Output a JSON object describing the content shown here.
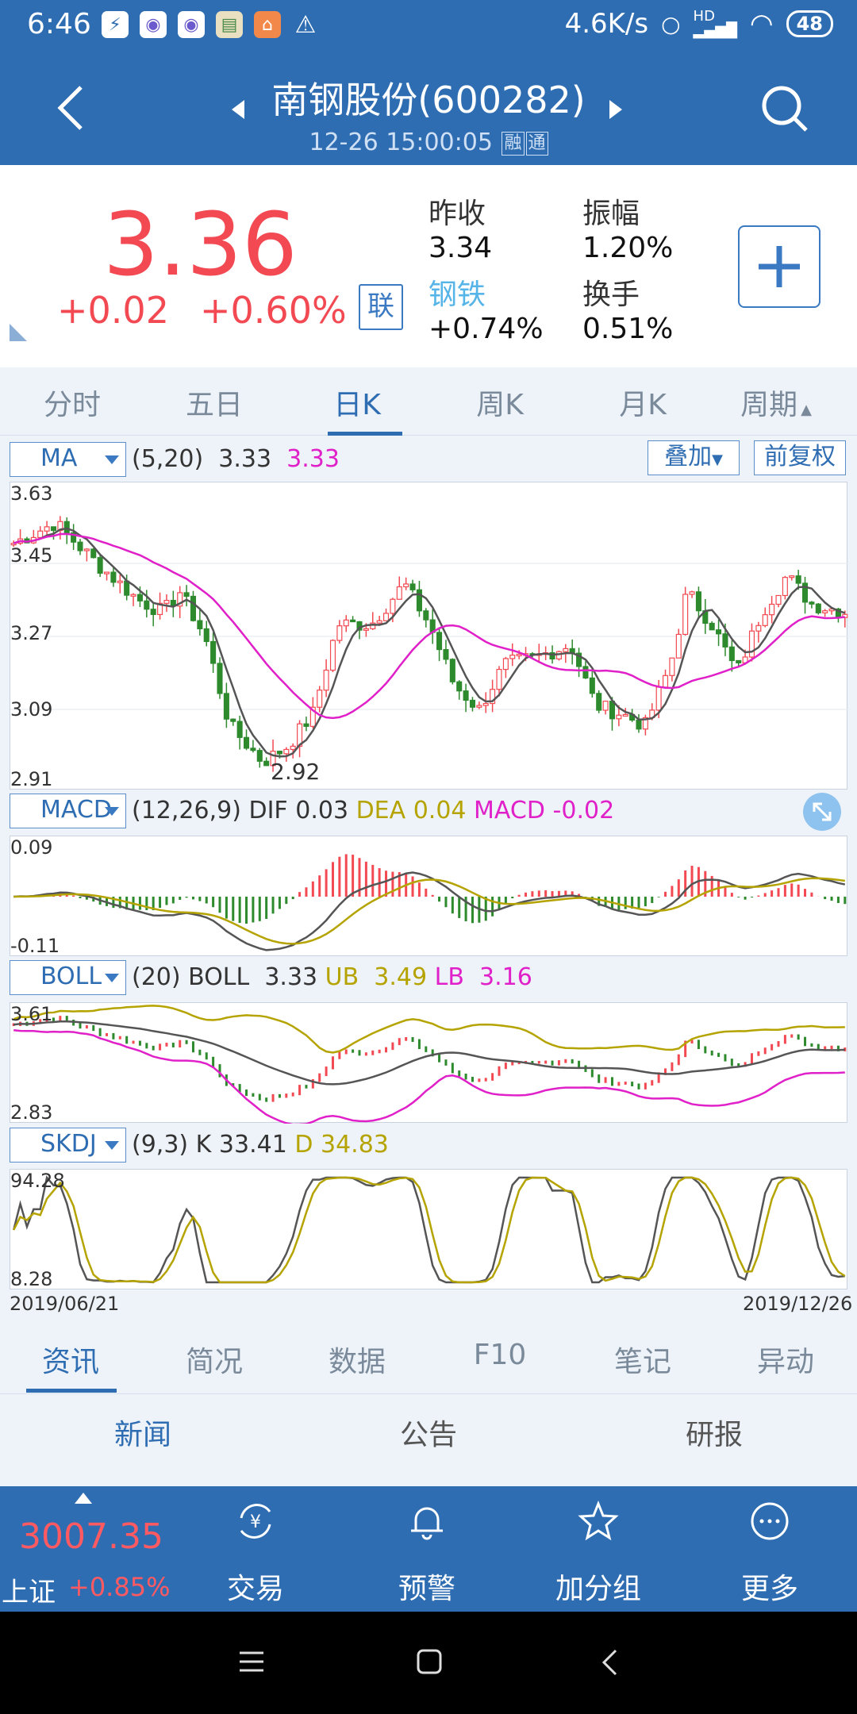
{
  "status_bar": {
    "time": "6:46",
    "net_speed": "4.6K/s",
    "battery": "48",
    "hd_label": "HD"
  },
  "header": {
    "title": "南钢股份(600282)",
    "datetime": "12-26 15:00:05",
    "tags": [
      "融",
      "通"
    ]
  },
  "quote": {
    "price": "3.36",
    "change": "+0.02",
    "change_pct": "+0.60%",
    "lian_label": "联",
    "prev_close_label": "昨收",
    "prev_close": "3.34",
    "amplitude_label": "振幅",
    "amplitude": "1.20%",
    "sector_label": "钢铁",
    "sector_change": "+0.74%",
    "turnover_label": "换手",
    "turnover": "0.51%"
  },
  "period_tabs": {
    "tabs": [
      "分时",
      "五日",
      "日K",
      "周K",
      "月K",
      "周期"
    ],
    "active": "日K"
  },
  "ma": {
    "selector": "MA",
    "params": "(5,20)",
    "v1": "3.33",
    "v2": "3.33",
    "overlay_button": "叠加",
    "adjust_button": "前复权",
    "y_labels": [
      "3.63",
      "3.45",
      "3.27",
      "3.09",
      "2.91"
    ],
    "low_marker": "2.92"
  },
  "macd": {
    "selector": "MACD",
    "params": "(12,26,9)",
    "dif_label": "DIF",
    "dif": "0.03",
    "dea_label": "DEA",
    "dea": "0.04",
    "macd_label": "MACD",
    "macd": "-0.02",
    "y_top": "0.09",
    "y_bottom": "-0.11"
  },
  "boll": {
    "selector": "BOLL",
    "params": "(20)",
    "boll_label": "BOLL",
    "boll": "3.33",
    "ub_label": "UB",
    "ub": "3.49",
    "lb_label": "LB",
    "lb": "3.16",
    "y_top": "3.61",
    "y_bottom": "2.83"
  },
  "skdj": {
    "selector": "SKDJ",
    "params": "(9,3)",
    "k_label": "K",
    "k": "33.41",
    "d_label": "D",
    "d": "34.83",
    "y_top": "94.28",
    "y_bottom": "8.28",
    "date_start": "2019/06/21",
    "date_end": "2019/12/26"
  },
  "info_tabs": {
    "tabs": [
      "资讯",
      "简况",
      "数据",
      "F10",
      "笔记",
      "异动"
    ],
    "active": "资讯"
  },
  "sub_tabs": {
    "tabs": [
      "新闻",
      "公告",
      "研报"
    ],
    "active": "新闻"
  },
  "bottom_nav": {
    "index_value": "3007.35",
    "index_name": "上证",
    "index_change": "+0.85%",
    "items": [
      "交易",
      "预警",
      "加分组",
      "更多"
    ]
  },
  "colors": {
    "brand": "#2f6db3",
    "up": "#f24952",
    "down": "#2d8a2d",
    "ma20": "#e020c8",
    "dea": "#b5a300"
  }
}
